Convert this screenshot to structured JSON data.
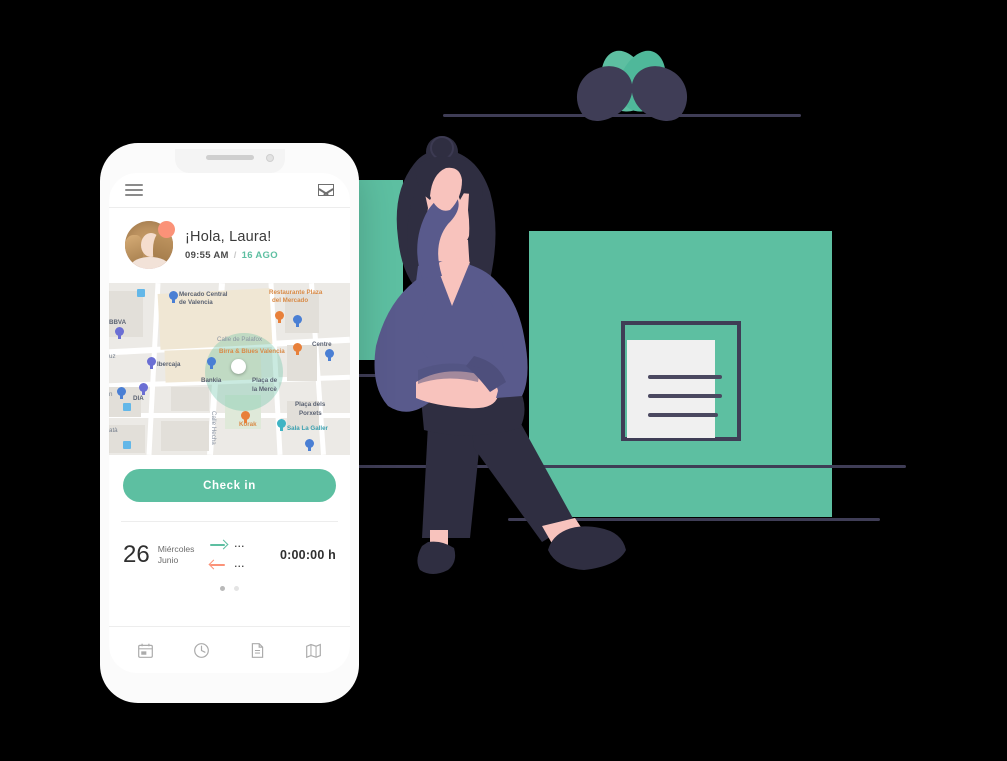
{
  "meta": {
    "scene": "mobile time-tracking app mockup with flat illustration",
    "colors": {
      "green": "#5dbfa1",
      "dark_navy": "#3f3d56",
      "coral": "#fb9278",
      "purple_shirt": "#595a8c",
      "skin": "#f8c3bd",
      "hair_dark": "#2f2e41",
      "background": "#000000"
    }
  },
  "phone": {
    "header": {
      "menu_icon": "hamburger-icon",
      "mail_icon": "envelope-icon"
    },
    "greeting": {
      "avatar_icon": "user-avatar",
      "notification_icon": "notification-dot",
      "hello": "¡Hola, Laura!",
      "time": "09:55 AM",
      "separator": "/",
      "ago": "16 AGO"
    },
    "map": {
      "labels": [
        "Mercado Central",
        "de Valencia",
        "Restaurante Plaza",
        "del Mercado",
        "BBVA",
        "Calle de Palafox",
        "Birra & Blues Valencia",
        "Centre",
        "Ibercaja",
        "Bankia",
        "Plaça de",
        "la Mercè",
        "DIA",
        "Plaça dels",
        "Porxets",
        "Calle Hecha",
        "Korak",
        "Sala La Galler",
        "uz",
        "n",
        "atà"
      ],
      "current_location_icon": "current-location-dot"
    },
    "checkin": {
      "button_label": "Check in"
    },
    "day_entry": {
      "day_number": "26",
      "weekday": "Miércoles",
      "month": "Junio",
      "in_icon": "arrow-right-icon",
      "in_value": "...",
      "out_icon": "arrow-left-icon",
      "out_value": "...",
      "total": "0:00:00 h"
    },
    "pagination": {
      "dots": 2,
      "active": 0
    },
    "tabbar": {
      "items": [
        {
          "icon": "calendar-icon",
          "label": "Calendar"
        },
        {
          "icon": "clock-icon",
          "label": "Clock"
        },
        {
          "icon": "document-icon",
          "label": "Document"
        },
        {
          "icon": "map-book-icon",
          "label": "Map"
        }
      ]
    }
  },
  "illustration": {
    "lotus_icon": "lotus-plant-icon",
    "document_card_icon": "document-card-icon",
    "person_icon": "person-leaning-illustration",
    "green_panel_large": "green-panel",
    "green_panel_small": "green-panel-small",
    "rules": [
      "top-rule",
      "mid-rule",
      "lower-rule",
      "bottom-rule",
      "small-rule"
    ]
  }
}
